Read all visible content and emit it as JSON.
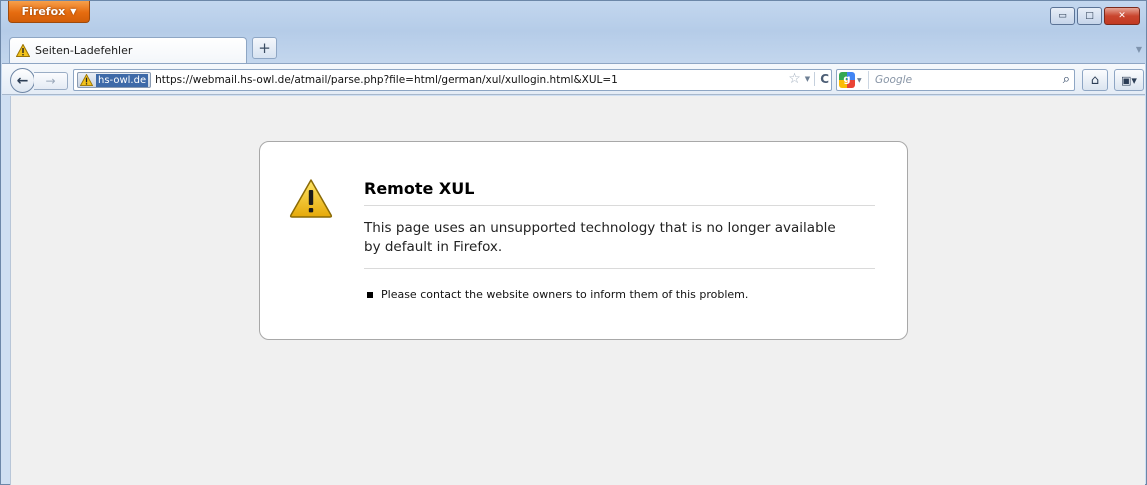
{
  "titlebar": {
    "app_button_label": "Firefox",
    "window_controls": {
      "minimize": "▭",
      "maximize": "□",
      "close": "✕"
    }
  },
  "tabs": [
    {
      "label": "Seiten-Ladefehler",
      "icon": "warning-icon",
      "active": true
    }
  ],
  "new_tab_label": "+",
  "navbar": {
    "identity_host": "hs-owl.de",
    "url": "https://webmail.hs-owl.de/atmail/parse.php?file=html/german/xul/xullogin.html&XUL=1",
    "search_placeholder": "Google",
    "search_engine": "Google"
  },
  "error_page": {
    "title": "Remote XUL",
    "description": "This page uses an unsupported technology that is no longer available by default in Firefox.",
    "hints": [
      "Please contact the website owners to inform them of this problem."
    ]
  },
  "colors": {
    "firefox_button": "#e66c10",
    "chrome_blue": "#b5cce8",
    "content_bg": "#f0f0f0",
    "warning_yellow": "#f5c518"
  }
}
